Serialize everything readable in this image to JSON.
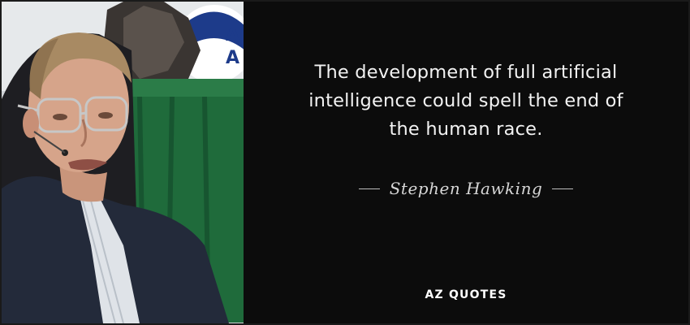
{
  "quote": {
    "line1": "The development of full artificial",
    "line2": "intelligence could spell the end of",
    "line3": "the human race."
  },
  "author": "Stephen Hawking",
  "brand": "AZ QUOTES",
  "photo": {
    "background_text_1": "A",
    "background_text_2": "A"
  },
  "colors": {
    "panel_background": "#0c0c0c",
    "quote_text": "#f2f2f2",
    "author_text": "#d6d6d6",
    "tablecloth_green": "#1f6b3b"
  }
}
